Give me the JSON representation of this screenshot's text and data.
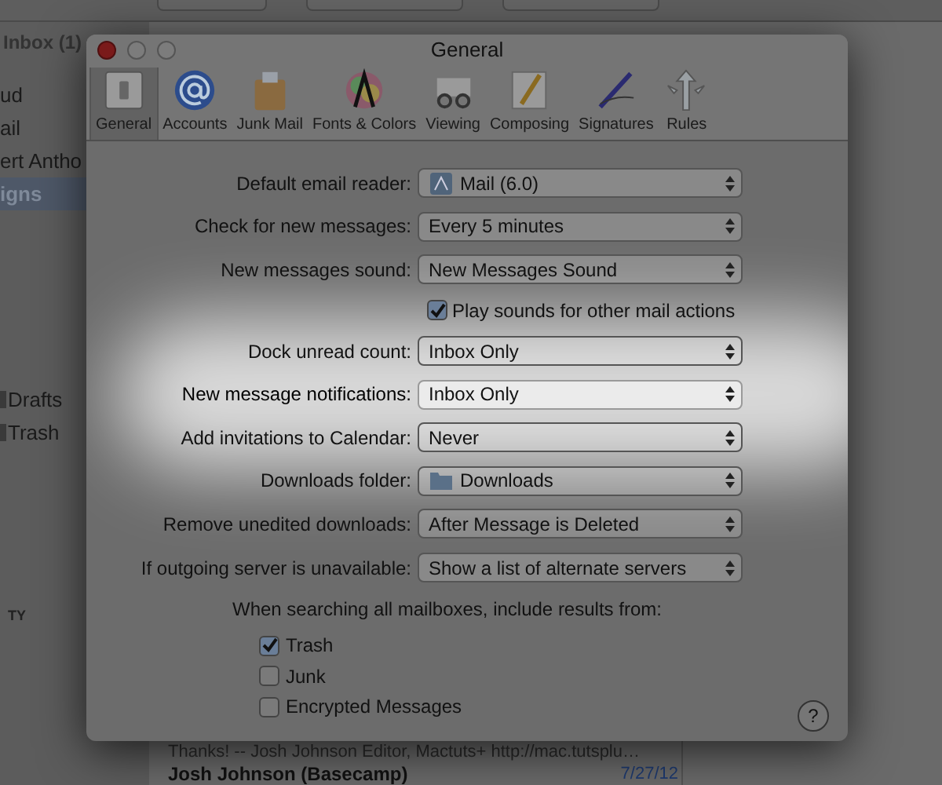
{
  "background": {
    "mailbox_title": "Inbox (1)",
    "sidebar_items": [
      {
        "label": "ud",
        "selected": false,
        "icon": false
      },
      {
        "label": "ail",
        "selected": false,
        "icon": false
      },
      {
        "label": "ert Antho",
        "selected": false,
        "icon": false
      },
      {
        "label": "igns",
        "selected": true,
        "icon": false
      },
      {
        "label": "Drafts",
        "selected": false,
        "icon": true
      },
      {
        "label": "Trash",
        "selected": false,
        "icon": true
      }
    ],
    "section_label": "TY",
    "message_preview": "Thanks! -- Josh Johnson Editor, Mactuts+ http://mac.tutsplu…",
    "message_sender": "Josh Johnson (Basecamp)",
    "message_date": "7/27/12"
  },
  "window": {
    "title": "General"
  },
  "toolbar": [
    {
      "label": "General",
      "selected": true
    },
    {
      "label": "Accounts",
      "selected": false
    },
    {
      "label": "Junk Mail",
      "selected": false
    },
    {
      "label": "Fonts & Colors",
      "selected": false
    },
    {
      "label": "Viewing",
      "selected": false
    },
    {
      "label": "Composing",
      "selected": false
    },
    {
      "label": "Signatures",
      "selected": false
    },
    {
      "label": "Rules",
      "selected": false
    }
  ],
  "settings": [
    {
      "kind": "app_popup",
      "label": "Default email reader:",
      "value": "Mail (6.0)",
      "highlighted": false
    },
    {
      "kind": "popup",
      "label": "Check for new messages:",
      "value": "Every 5 minutes",
      "highlighted": false
    },
    {
      "kind": "popup",
      "label": "New messages sound:",
      "value": "New Messages Sound",
      "highlighted": false
    },
    {
      "kind": "checkbox",
      "label": "Play sounds for other mail actions",
      "checked": true
    },
    {
      "kind": "popup",
      "label": "Dock unread count:",
      "value": "Inbox Only",
      "highlighted": false
    },
    {
      "kind": "popup",
      "label": "New message notifications:",
      "value": "Inbox Only",
      "highlighted": true
    },
    {
      "kind": "popup",
      "label": "Add invitations to Calendar:",
      "value": "Never",
      "highlighted": false
    },
    {
      "kind": "folder_popup",
      "label": "Downloads folder:",
      "value": "Downloads",
      "highlighted": false
    },
    {
      "kind": "popup",
      "label": "Remove unedited downloads:",
      "value": "After Message is Deleted",
      "highlighted": false
    },
    {
      "kind": "popup",
      "label": "If outgoing server is unavailable:",
      "value": "Show a list of alternate servers",
      "highlighted": false
    }
  ],
  "search_section": {
    "label": "When searching all mailboxes, include results from:",
    "options": [
      {
        "label": "Trash",
        "checked": true
      },
      {
        "label": "Junk",
        "checked": false
      },
      {
        "label": "Encrypted Messages",
        "checked": false
      }
    ]
  },
  "help_button": "?"
}
